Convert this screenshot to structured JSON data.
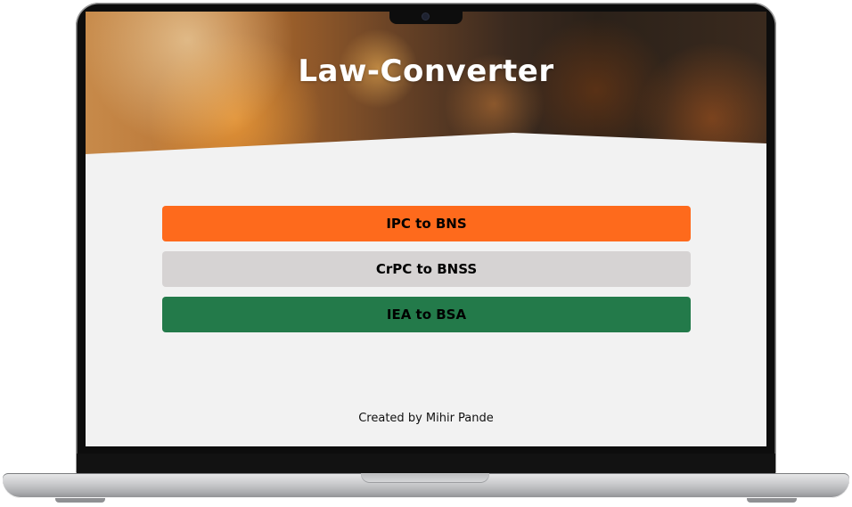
{
  "app": {
    "title": "Law-Converter"
  },
  "menu": {
    "buttons": [
      {
        "label": "IPC to BNS",
        "color": "#fe6a1c"
      },
      {
        "label": "CrPC to BNSS",
        "color": "#d6d3d3"
      },
      {
        "label": "IEA to BSA",
        "color": "#237a4a"
      }
    ]
  },
  "footer": {
    "credit": "Created by Mihir Pande"
  }
}
